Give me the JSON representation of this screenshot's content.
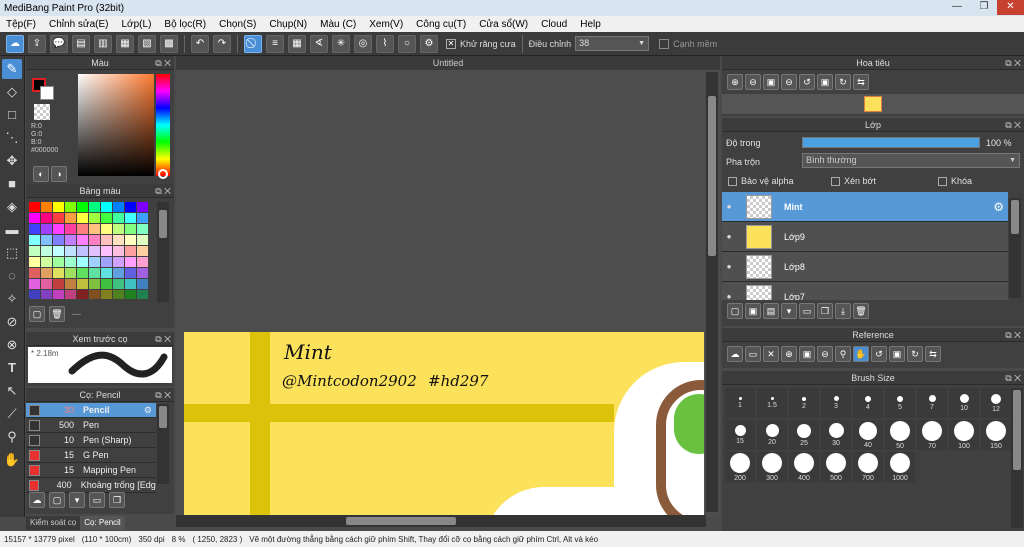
{
  "window": {
    "title": "MediBang Paint Pro (32bit)",
    "minimize": "—",
    "restore": "❐",
    "close": "✕"
  },
  "menu": [
    "Tệp(F)",
    "Chỉnh sửa(E)",
    "Lớp(L)",
    "Bộ lọc(R)",
    "Chọn(S)",
    "Chụp(N)",
    "Màu (C)",
    "Xem(V)",
    "Công cụ(T)",
    "Cửa sổ(W)",
    "Cloud",
    "Help"
  ],
  "toolbar": {
    "antialias_label": "Khử răng cưa",
    "adjust_label": "Điều chỉnh",
    "adjust_value": "38",
    "sharp_label": "Cạnh mềm"
  },
  "color_panel": {
    "title": "Màu",
    "r": "R:0",
    "g": "G:0",
    "b": "B:0",
    "hex": "#000000"
  },
  "palette_panel": {
    "title": "Bảng màu",
    "dash": "---"
  },
  "preview_panel": {
    "title": "Xem trước cọ",
    "size": "2.18m"
  },
  "brush_panel": {
    "title": "Cọ: Pencil",
    "items": [
      {
        "size": "30",
        "name": "Pencil",
        "color": "#333333",
        "selected": true
      },
      {
        "size": "500",
        "name": "Pen",
        "color": "#333333"
      },
      {
        "size": "10",
        "name": "Pen (Sharp)",
        "color": "#333333"
      },
      {
        "size": "15",
        "name": "G Pen",
        "color": "#e83030"
      },
      {
        "size": "15",
        "name": "Mapping Pen",
        "color": "#e83030"
      },
      {
        "size": "400",
        "name": "Khoảng trống [Edge",
        "color": "#e83030"
      }
    ]
  },
  "bottom_tabs": {
    "tab1": "Kiểm soát cọ",
    "tab2": "Cọ: Pencil"
  },
  "canvas": {
    "tab": "Untitled",
    "text1": "Mint",
    "text2": "@Mintcodon2902",
    "text3": "#hd297"
  },
  "navigator_panel": {
    "title": "Hoa tiêu"
  },
  "layer_panel": {
    "title": "Lớp",
    "opacity_label": "Độ trong",
    "opacity_value": "100 %",
    "opacity_fraction": 1.0,
    "blend_label": "Pha trộn",
    "blend_value": "Bình thường",
    "protect_alpha": "Bảo vệ alpha",
    "clip": "Xén bớt",
    "lock": "Khóa",
    "layers": [
      {
        "name": "Mint",
        "selected": true
      },
      {
        "name": "Lớp9"
      },
      {
        "name": "Lớp8"
      },
      {
        "name": "Lớp7"
      }
    ]
  },
  "reference_panel": {
    "title": "Reference"
  },
  "brush_size_panel": {
    "title": "Brush Size",
    "sizes": [
      "1",
      "1.5",
      "2",
      "3",
      "4",
      "5",
      "7",
      "10",
      "12",
      "15",
      "20",
      "25",
      "30",
      "40",
      "50",
      "70",
      "100",
      "150",
      "200",
      "300",
      "400",
      "500",
      "700",
      "1000"
    ]
  },
  "statusbar": {
    "size": "15157 * 13779 pixel",
    "cm": "(110 * 100cm)",
    "dpi": "350 dpi",
    "zoom": "8 %",
    "coords": "( 1250, 2823 )",
    "hint": "Vẽ một đường thẳng bằng cách giữ phím Shift, Thay đổi cỡ cọ bằng cách giữ phím Ctrl, Alt và kéo"
  }
}
